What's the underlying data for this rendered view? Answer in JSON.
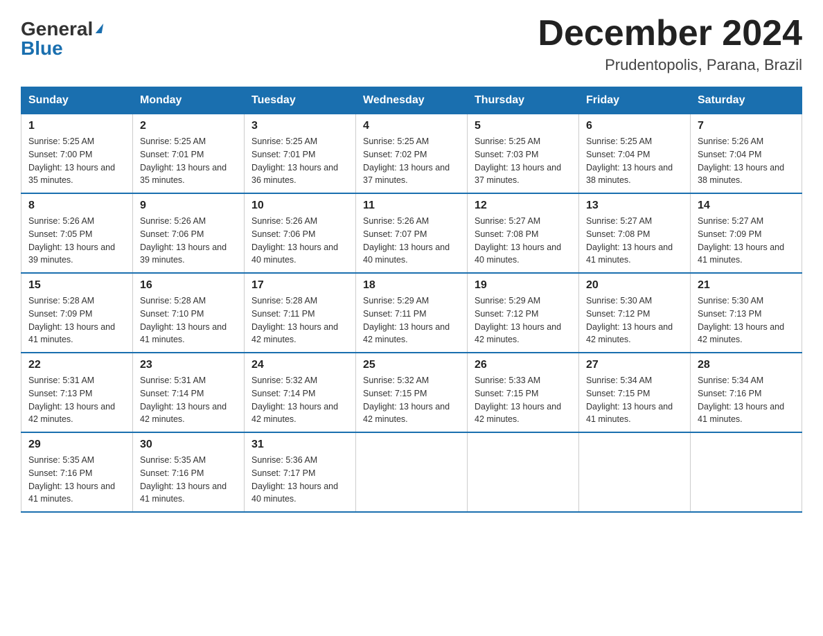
{
  "header": {
    "logo_general": "General",
    "logo_blue": "Blue",
    "month_title": "December 2024",
    "location": "Prudentopolis, Parana, Brazil"
  },
  "days_of_week": [
    "Sunday",
    "Monday",
    "Tuesday",
    "Wednesday",
    "Thursday",
    "Friday",
    "Saturday"
  ],
  "weeks": [
    [
      {
        "day": "1",
        "sunrise": "5:25 AM",
        "sunset": "7:00 PM",
        "daylight": "13 hours and 35 minutes."
      },
      {
        "day": "2",
        "sunrise": "5:25 AM",
        "sunset": "7:01 PM",
        "daylight": "13 hours and 35 minutes."
      },
      {
        "day": "3",
        "sunrise": "5:25 AM",
        "sunset": "7:01 PM",
        "daylight": "13 hours and 36 minutes."
      },
      {
        "day": "4",
        "sunrise": "5:25 AM",
        "sunset": "7:02 PM",
        "daylight": "13 hours and 37 minutes."
      },
      {
        "day": "5",
        "sunrise": "5:25 AM",
        "sunset": "7:03 PM",
        "daylight": "13 hours and 37 minutes."
      },
      {
        "day": "6",
        "sunrise": "5:25 AM",
        "sunset": "7:04 PM",
        "daylight": "13 hours and 38 minutes."
      },
      {
        "day": "7",
        "sunrise": "5:26 AM",
        "sunset": "7:04 PM",
        "daylight": "13 hours and 38 minutes."
      }
    ],
    [
      {
        "day": "8",
        "sunrise": "5:26 AM",
        "sunset": "7:05 PM",
        "daylight": "13 hours and 39 minutes."
      },
      {
        "day": "9",
        "sunrise": "5:26 AM",
        "sunset": "7:06 PM",
        "daylight": "13 hours and 39 minutes."
      },
      {
        "day": "10",
        "sunrise": "5:26 AM",
        "sunset": "7:06 PM",
        "daylight": "13 hours and 40 minutes."
      },
      {
        "day": "11",
        "sunrise": "5:26 AM",
        "sunset": "7:07 PM",
        "daylight": "13 hours and 40 minutes."
      },
      {
        "day": "12",
        "sunrise": "5:27 AM",
        "sunset": "7:08 PM",
        "daylight": "13 hours and 40 minutes."
      },
      {
        "day": "13",
        "sunrise": "5:27 AM",
        "sunset": "7:08 PM",
        "daylight": "13 hours and 41 minutes."
      },
      {
        "day": "14",
        "sunrise": "5:27 AM",
        "sunset": "7:09 PM",
        "daylight": "13 hours and 41 minutes."
      }
    ],
    [
      {
        "day": "15",
        "sunrise": "5:28 AM",
        "sunset": "7:09 PM",
        "daylight": "13 hours and 41 minutes."
      },
      {
        "day": "16",
        "sunrise": "5:28 AM",
        "sunset": "7:10 PM",
        "daylight": "13 hours and 41 minutes."
      },
      {
        "day": "17",
        "sunrise": "5:28 AM",
        "sunset": "7:11 PM",
        "daylight": "13 hours and 42 minutes."
      },
      {
        "day": "18",
        "sunrise": "5:29 AM",
        "sunset": "7:11 PM",
        "daylight": "13 hours and 42 minutes."
      },
      {
        "day": "19",
        "sunrise": "5:29 AM",
        "sunset": "7:12 PM",
        "daylight": "13 hours and 42 minutes."
      },
      {
        "day": "20",
        "sunrise": "5:30 AM",
        "sunset": "7:12 PM",
        "daylight": "13 hours and 42 minutes."
      },
      {
        "day": "21",
        "sunrise": "5:30 AM",
        "sunset": "7:13 PM",
        "daylight": "13 hours and 42 minutes."
      }
    ],
    [
      {
        "day": "22",
        "sunrise": "5:31 AM",
        "sunset": "7:13 PM",
        "daylight": "13 hours and 42 minutes."
      },
      {
        "day": "23",
        "sunrise": "5:31 AM",
        "sunset": "7:14 PM",
        "daylight": "13 hours and 42 minutes."
      },
      {
        "day": "24",
        "sunrise": "5:32 AM",
        "sunset": "7:14 PM",
        "daylight": "13 hours and 42 minutes."
      },
      {
        "day": "25",
        "sunrise": "5:32 AM",
        "sunset": "7:15 PM",
        "daylight": "13 hours and 42 minutes."
      },
      {
        "day": "26",
        "sunrise": "5:33 AM",
        "sunset": "7:15 PM",
        "daylight": "13 hours and 42 minutes."
      },
      {
        "day": "27",
        "sunrise": "5:34 AM",
        "sunset": "7:15 PM",
        "daylight": "13 hours and 41 minutes."
      },
      {
        "day": "28",
        "sunrise": "5:34 AM",
        "sunset": "7:16 PM",
        "daylight": "13 hours and 41 minutes."
      }
    ],
    [
      {
        "day": "29",
        "sunrise": "5:35 AM",
        "sunset": "7:16 PM",
        "daylight": "13 hours and 41 minutes."
      },
      {
        "day": "30",
        "sunrise": "5:35 AM",
        "sunset": "7:16 PM",
        "daylight": "13 hours and 41 minutes."
      },
      {
        "day": "31",
        "sunrise": "5:36 AM",
        "sunset": "7:17 PM",
        "daylight": "13 hours and 40 minutes."
      },
      null,
      null,
      null,
      null
    ]
  ]
}
